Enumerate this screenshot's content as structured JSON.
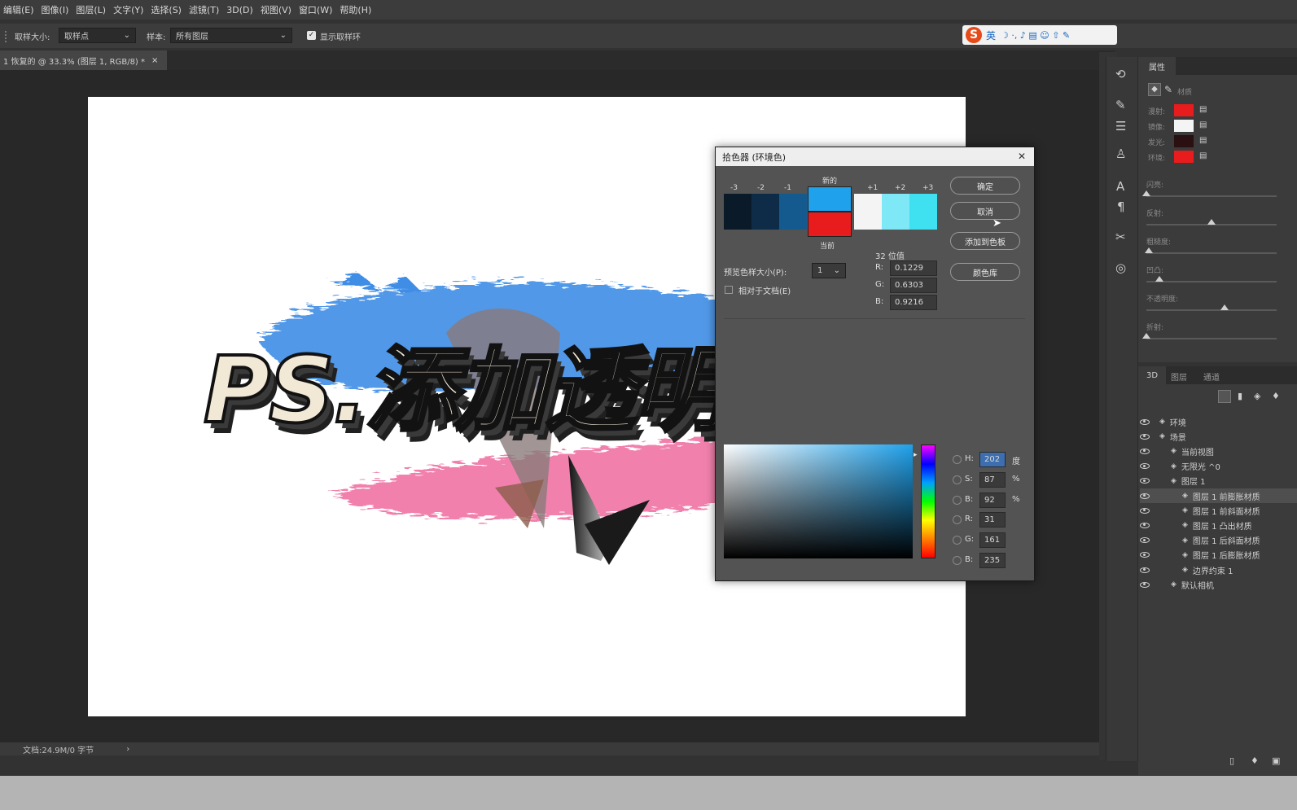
{
  "menu": [
    "编辑(E)",
    "图像(I)",
    "图层(L)",
    "文字(Y)",
    "选择(S)",
    "滤镜(T)",
    "3D(D)",
    "视图(V)",
    "窗口(W)",
    "帮助(H)"
  ],
  "options": {
    "sample_size_label": "取样大小:",
    "sample_size_value": "取样点",
    "sample_label": "样本:",
    "sample_value": "所有图层",
    "show_ring_label": "显示取样环"
  },
  "ime": {
    "logo": "S",
    "lang": "英",
    "icons": "☽ ·, ♪ ▤ ☺ ⇧ ✎"
  },
  "document": {
    "tab_title": "1 恢复的 @ 33.3% (图层 1, RGB/8) *",
    "tab_close": "×",
    "status": "文档:24.9M/0 字节",
    "status_arrow": "›"
  },
  "artwork": {
    "title": "PS.添加透明贴图"
  },
  "properties": {
    "tab": "属性",
    "header_label": "材质",
    "swatches": [
      {
        "label": "漫射:",
        "color": "#e81c1c"
      },
      {
        "label": "镜像:",
        "color": "#f4f4f4"
      },
      {
        "label": "发光:",
        "color": "#2a1010"
      },
      {
        "label": "环境:",
        "color": "#e81c1c"
      }
    ],
    "sliders": [
      {
        "label": "闪亮:",
        "pos": 0
      },
      {
        "label": "反射:",
        "pos": 0.5
      },
      {
        "label": "粗糙度:",
        "pos": 0.02
      },
      {
        "label": "凹凸:",
        "pos": 0.1
      },
      {
        "label": "不透明度:",
        "pos": 0.6
      },
      {
        "label": "折射:",
        "pos": 0
      }
    ]
  },
  "panel3d": {
    "tabs": [
      "3D",
      "图层",
      "通道"
    ],
    "rows": [
      {
        "name": "环境",
        "indent": 0,
        "selected": false
      },
      {
        "name": "场景",
        "indent": 0,
        "selected": false
      },
      {
        "name": "当前视图",
        "indent": 1,
        "selected": false
      },
      {
        "name": "无限光 ^0",
        "indent": 1,
        "selected": false
      },
      {
        "name": "图层 1",
        "indent": 1,
        "selected": false
      },
      {
        "name": "图层 1 前膨胀材质",
        "indent": 2,
        "selected": true
      },
      {
        "name": "图层 1 前斜面材质",
        "indent": 2,
        "selected": false
      },
      {
        "name": "图层 1 凸出材质",
        "indent": 2,
        "selected": false
      },
      {
        "name": "图层 1 后斜面材质",
        "indent": 2,
        "selected": false
      },
      {
        "name": "图层 1 后膨胀材质",
        "indent": 2,
        "selected": false
      },
      {
        "name": "边界约束 1",
        "indent": 2,
        "selected": false
      },
      {
        "name": "默认相机",
        "indent": 1,
        "selected": false
      }
    ]
  },
  "picker": {
    "title": "拾色器 (环境色)",
    "close": "✕",
    "steps": [
      "-3",
      "-2",
      "-1",
      "+1",
      "+2",
      "+3"
    ],
    "new_label": "新的",
    "current_label": "当前",
    "new_color": "#1fa1eb",
    "current_color": "#e81c1c",
    "ramp_left": [
      "#0a1a28",
      "#0e2c48",
      "#155a8e"
    ],
    "ramp_right": [
      "#f4f4f4",
      "#7fe8f6",
      "#3fe0f0"
    ],
    "ok": "确定",
    "cancel": "取消",
    "add_swatch": "添加到色板",
    "color_lib": "颜色库",
    "sample_size_label": "预览色样大小(P):",
    "sample_size_value": "1",
    "relative_label": "相对于文档(E)",
    "bit_label": "32 位值",
    "r32": "0.1229",
    "g32": "0.6303",
    "b32": "0.9216",
    "hsb": [
      {
        "k": "H:",
        "v": "202",
        "u": "度"
      },
      {
        "k": "S:",
        "v": "87",
        "u": "%"
      },
      {
        "k": "B:",
        "v": "92",
        "u": "%"
      }
    ],
    "rgb": [
      {
        "k": "R:",
        "v": "31"
      },
      {
        "k": "G:",
        "v": "161"
      },
      {
        "k": "B:",
        "v": "235"
      }
    ]
  }
}
